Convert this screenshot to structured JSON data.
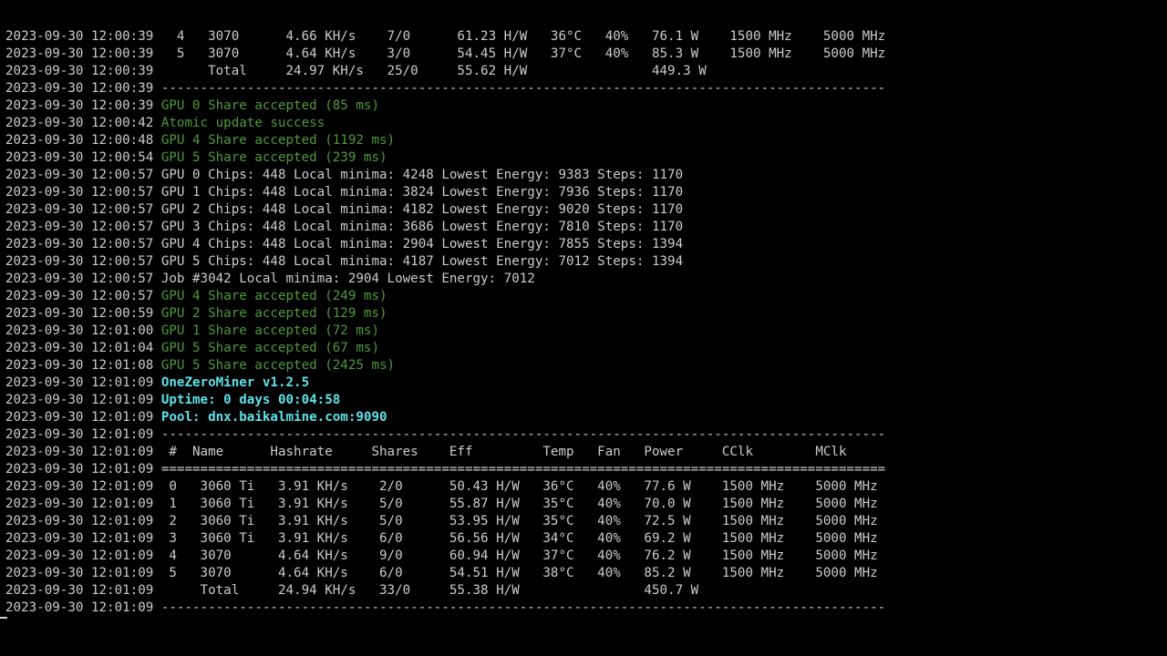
{
  "terminal": {
    "lines": [
      {
        "ts": "2023-09-30 12:00:39",
        "text": "  4   3070      4.66 KH/s    7/0      61.23 H/W   36°C   40%   76.1 W    1500 MHz    5000 MHz",
        "style": "normal"
      },
      {
        "ts": "2023-09-30 12:00:39",
        "text": "  5   3070      4.64 KH/s    3/0      54.45 H/W   37°C   40%   85.3 W    1500 MHz    5000 MHz",
        "style": "normal"
      },
      {
        "ts": "2023-09-30 12:00:39",
        "text": "      Total     24.97 KH/s   25/0     55.62 H/W                449.3 W",
        "style": "normal"
      },
      {
        "ts": "2023-09-30 12:00:39",
        "text": "---------------------------------------------------------------------------------------------",
        "style": "normal"
      },
      {
        "ts": "2023-09-30 12:00:39",
        "text": "GPU 0 Share accepted (85 ms)",
        "style": "green"
      },
      {
        "ts": "2023-09-30 12:00:42",
        "text": "Atomic update success",
        "style": "green"
      },
      {
        "ts": "2023-09-30 12:00:48",
        "text": "GPU 4 Share accepted (1192 ms)",
        "style": "green"
      },
      {
        "ts": "2023-09-30 12:00:54",
        "text": "GPU 5 Share accepted (239 ms)",
        "style": "green"
      },
      {
        "ts": "2023-09-30 12:00:57",
        "text": "GPU 0 Chips: 448 Local minima: 4248 Lowest Energy: 9383 Steps: 1170",
        "style": "normal"
      },
      {
        "ts": "2023-09-30 12:00:57",
        "text": "GPU 1 Chips: 448 Local minima: 3824 Lowest Energy: 7936 Steps: 1170",
        "style": "normal"
      },
      {
        "ts": "2023-09-30 12:00:57",
        "text": "GPU 2 Chips: 448 Local minima: 4182 Lowest Energy: 9020 Steps: 1170",
        "style": "normal"
      },
      {
        "ts": "2023-09-30 12:00:57",
        "text": "GPU 3 Chips: 448 Local minima: 3686 Lowest Energy: 7810 Steps: 1170",
        "style": "normal"
      },
      {
        "ts": "2023-09-30 12:00:57",
        "text": "GPU 4 Chips: 448 Local minima: 2904 Lowest Energy: 7855 Steps: 1394",
        "style": "normal"
      },
      {
        "ts": "2023-09-30 12:00:57",
        "text": "GPU 5 Chips: 448 Local minima: 4187 Lowest Energy: 7012 Steps: 1394",
        "style": "normal"
      },
      {
        "ts": "2023-09-30 12:00:57",
        "text": "Job #3042 Local minima: 2904 Lowest Energy: 7012",
        "style": "normal"
      },
      {
        "ts": "2023-09-30 12:00:57",
        "text": "GPU 4 Share accepted (249 ms)",
        "style": "green"
      },
      {
        "ts": "2023-09-30 12:00:59",
        "text": "GPU 2 Share accepted (129 ms)",
        "style": "green"
      },
      {
        "ts": "2023-09-30 12:01:00",
        "text": "GPU 1 Share accepted (72 ms)",
        "style": "green"
      },
      {
        "ts": "2023-09-30 12:01:04",
        "text": "GPU 5 Share accepted (67 ms)",
        "style": "green"
      },
      {
        "ts": "2023-09-30 12:01:08",
        "text": "GPU 5 Share accepted (2425 ms)",
        "style": "green"
      },
      {
        "ts": "2023-09-30 12:01:09",
        "text": "OneZeroMiner v1.2.5",
        "style": "cyan"
      },
      {
        "ts": "2023-09-30 12:01:09",
        "text": "Uptime: 0 days 00:04:58",
        "style": "cyan"
      },
      {
        "ts": "2023-09-30 12:01:09",
        "text": "Pool: dnx.baikalmine.com:9090",
        "style": "cyan"
      },
      {
        "ts": "2023-09-30 12:01:09",
        "text": "---------------------------------------------------------------------------------------------",
        "style": "normal"
      },
      {
        "ts": "2023-09-30 12:01:09",
        "text": " #  Name      Hashrate     Shares    Eff         Temp   Fan   Power     CClk        MClk",
        "style": "normal"
      },
      {
        "ts": "2023-09-30 12:01:09",
        "text": "=============================================================================================",
        "style": "normal"
      },
      {
        "ts": "2023-09-30 12:01:09",
        "text": " 0   3060 Ti   3.91 KH/s    2/0      50.43 H/W   36°C   40%   77.6 W    1500 MHz    5000 MHz",
        "style": "normal"
      },
      {
        "ts": "2023-09-30 12:01:09",
        "text": " 1   3060 Ti   3.91 KH/s    5/0      55.87 H/W   35°C   40%   70.0 W    1500 MHz    5000 MHz",
        "style": "normal"
      },
      {
        "ts": "2023-09-30 12:01:09",
        "text": " 2   3060 Ti   3.91 KH/s    5/0      53.95 H/W   35°C   40%   72.5 W    1500 MHz    5000 MHz",
        "style": "normal"
      },
      {
        "ts": "2023-09-30 12:01:09",
        "text": " 3   3060 Ti   3.91 KH/s    6/0      56.56 H/W   34°C   40%   69.2 W    1500 MHz    5000 MHz",
        "style": "normal"
      },
      {
        "ts": "2023-09-30 12:01:09",
        "text": " 4   3070      4.64 KH/s    9/0      60.94 H/W   37°C   40%   76.2 W    1500 MHz    5000 MHz",
        "style": "normal"
      },
      {
        "ts": "2023-09-30 12:01:09",
        "text": " 5   3070      4.64 KH/s    6/0      54.51 H/W   38°C   40%   85.2 W    1500 MHz    5000 MHz",
        "style": "normal"
      },
      {
        "ts": "2023-09-30 12:01:09",
        "text": "     Total     24.94 KH/s   33/0     55.38 H/W                450.7 W",
        "style": "normal"
      },
      {
        "ts": "2023-09-30 12:01:09",
        "text": "---------------------------------------------------------------------------------------------",
        "style": "normal"
      }
    ]
  },
  "colors": {
    "background": "#000000",
    "text": "#cccccc",
    "accepted_green": "#4e9a3a",
    "header_cyan": "#5fe2e9"
  }
}
